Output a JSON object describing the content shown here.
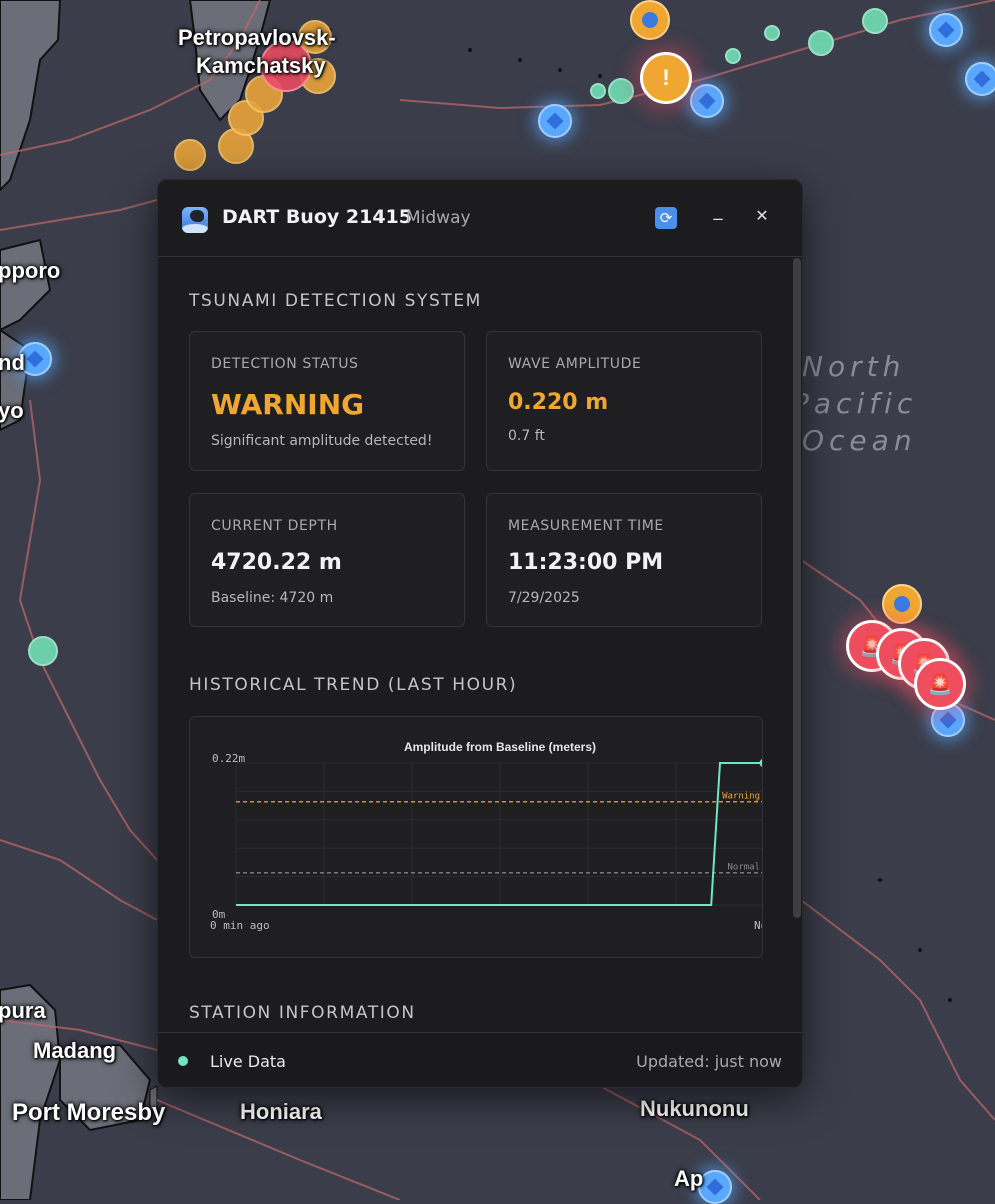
{
  "map": {
    "cities": [
      "Petropavlovsk-",
      "Kamchatsky",
      "pporo",
      "nd",
      "yo",
      "pura",
      "Madang",
      "Port Moresby",
      "Honiara",
      "Nukunonu",
      "Ap"
    ],
    "ocean_label": [
      "North",
      "Pacific",
      "Ocean"
    ],
    "warning_marker_icon": "warning-icon"
  },
  "panel": {
    "title": "DART Buoy 21415",
    "subtitle": "Midway",
    "refresh_icon": "refresh-icon",
    "minimize_label": "_",
    "close_label": "✕",
    "section_detection": "TSUNAMI DETECTION SYSTEM",
    "cards": {
      "detection_status": {
        "label": "DETECTION STATUS",
        "value": "WARNING",
        "sub": "Significant amplitude detected!"
      },
      "wave_amplitude": {
        "label": "WAVE AMPLITUDE",
        "value": "0.220 m",
        "sub": "0.7 ft"
      },
      "current_depth": {
        "label": "CURRENT DEPTH",
        "value": "4720.22 m",
        "sub": "Baseline: 4720 m"
      },
      "measurement_time": {
        "label": "MEASUREMENT TIME",
        "value": "11:23:00 PM",
        "sub": "7/29/2025"
      }
    },
    "section_trend": "HISTORICAL TREND (LAST HOUR)",
    "section_station": "STATION INFORMATION",
    "footer": {
      "live": "Live Data",
      "updated": "Updated: just now"
    }
  },
  "colors": {
    "warning": "#f0a732",
    "normal": "#6ee7c0",
    "accent": "#4a8fe8"
  },
  "chart_data": {
    "type": "line",
    "title": "Amplitude from Baseline (meters)",
    "x_labels": [
      "0 min ago",
      "Now"
    ],
    "y_labels": [
      "0.22m",
      "0m"
    ],
    "ylim": [
      0,
      0.22
    ],
    "x": [
      0,
      54,
      55,
      56,
      60
    ],
    "values": [
      0,
      0,
      0.22,
      0.22,
      0.22
    ],
    "thresholds": [
      {
        "name": "Warning",
        "value": 0.16,
        "color": "#f0a732"
      },
      {
        "name": "Normal",
        "value": 0.05,
        "color": "#8a8a90"
      }
    ],
    "grid": true
  }
}
